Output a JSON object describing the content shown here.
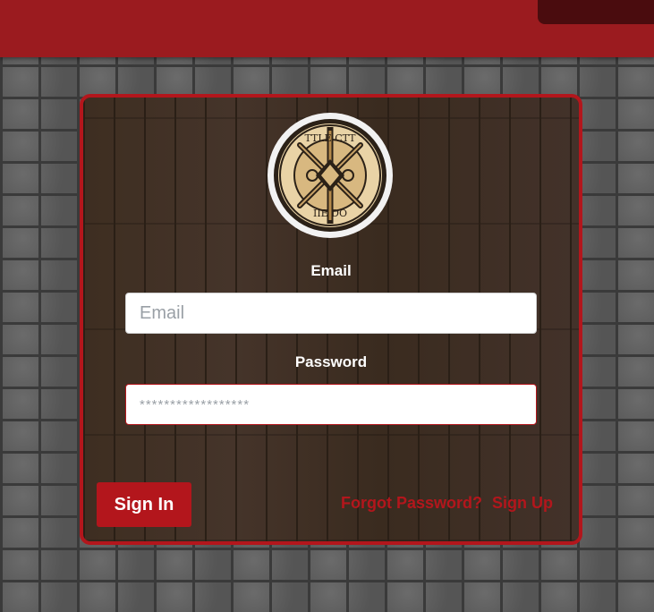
{
  "form": {
    "email_label": "Email",
    "email_placeholder": "Email",
    "password_label": "Password",
    "password_placeholder": "******************",
    "signin_label": "Sign In",
    "forgot_label": "Forgot Password?",
    "signup_label": "Sign Up"
  },
  "logo": {
    "emblem": "crossed-swords-dice-emblem",
    "text_top": "TTLE CTT",
    "text_bottom": "IIE DO"
  },
  "colors": {
    "brand_red": "#b3161c",
    "header_red": "#9b1b1f",
    "header_tab": "#4a0c0e",
    "wood": "#3a2b1f",
    "stone": "#5a5a5a"
  },
  "icons": {
    "logo": "emblem-icon"
  }
}
